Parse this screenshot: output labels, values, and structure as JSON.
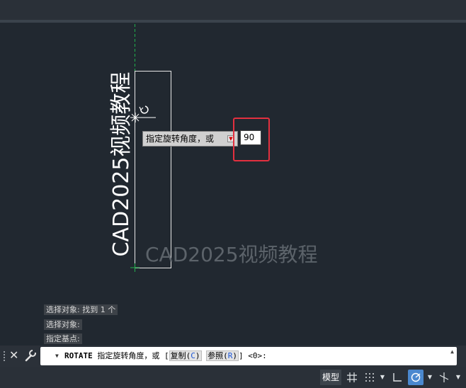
{
  "canvas": {
    "rotated_text": "CAD2025视频教程",
    "preview_text": "CAD2025视频教程"
  },
  "dynamic_prompt": {
    "label": "指定旋转角度，或",
    "input_value": "90"
  },
  "history": [
    "选择对象: 找到 1 个",
    "选择对象:",
    "指定基点:"
  ],
  "command_line": {
    "command": "ROTATE",
    "prompt": "指定旋转角度，或 [",
    "options": [
      {
        "label": "复制",
        "key": "C"
      },
      {
        "label": "参照",
        "key": "R"
      }
    ],
    "default": "] <0>:"
  },
  "status_bar": {
    "model_tab": "模型"
  },
  "colors": {
    "background": "#212830",
    "highlight": "#e3303f",
    "guide_line": "#22b14c",
    "active_toggle": "#4a88cf"
  }
}
